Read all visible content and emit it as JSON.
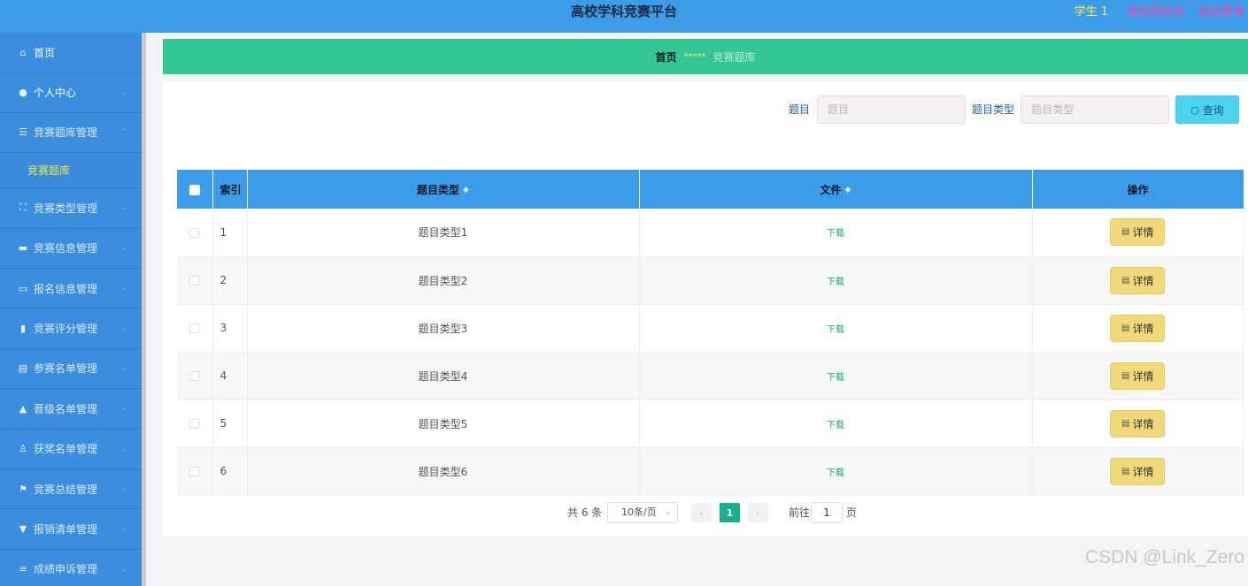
{
  "header": {
    "title": "高校学科竞赛平台",
    "user": "学生 1",
    "back_to_front": "退出到前台",
    "logout": "退出登录"
  },
  "sidebar": {
    "items": [
      {
        "label": "首页",
        "icon": "home-icon"
      },
      {
        "label": "个人中心",
        "icon": "user-icon"
      },
      {
        "label": "竞赛题库管理",
        "icon": "list-icon"
      },
      {
        "label": "竞赛类型管理",
        "icon": "expand-icon"
      },
      {
        "label": "竞赛信息管理",
        "icon": "briefcase-icon"
      },
      {
        "label": "报名信息管理",
        "icon": "message-icon"
      },
      {
        "label": "竞赛评分管理",
        "icon": "chart-icon"
      },
      {
        "label": "参赛名单管理",
        "icon": "clipboard-icon"
      },
      {
        "label": "晋级名单管理",
        "icon": "person-icon"
      },
      {
        "label": "获奖名单管理",
        "icon": "award-icon"
      },
      {
        "label": "竞赛总结管理",
        "icon": "flag-icon"
      },
      {
        "label": "报销清单管理",
        "icon": "pin-icon"
      },
      {
        "label": "成绩申诉管理",
        "icon": "menu-icon"
      }
    ],
    "sub_item": "竞赛题库"
  },
  "breadcrumb": {
    "home": "首页",
    "separator": "*****",
    "current": "竞赛题库"
  },
  "search": {
    "label_title": "题目",
    "placeholder_title": "题目",
    "label_type": "题目类型",
    "placeholder_type": "题目类型",
    "button": "查询"
  },
  "table": {
    "headers": {
      "index": "索引",
      "type": "题目类型",
      "file": "文件",
      "action": "操作"
    },
    "rows": [
      {
        "index": "1",
        "type": "题目类型1",
        "file": "下载",
        "action": "详情"
      },
      {
        "index": "2",
        "type": "题目类型2",
        "file": "下载",
        "action": "详情"
      },
      {
        "index": "3",
        "type": "题目类型3",
        "file": "下载",
        "action": "详情"
      },
      {
        "index": "4",
        "type": "题目类型4",
        "file": "下载",
        "action": "详情"
      },
      {
        "index": "5",
        "type": "题目类型5",
        "file": "下载",
        "action": "详情"
      },
      {
        "index": "6",
        "type": "题目类型6",
        "file": "下载",
        "action": "详情"
      }
    ]
  },
  "pagination": {
    "total": "共 6 条",
    "page_size": "10条/页",
    "current_page": "1",
    "goto_prefix": "前往",
    "goto_value": "1",
    "goto_suffix": "页"
  },
  "watermark": "CSDN @Link_Zero",
  "colors": {
    "header": "#3c9ce8",
    "sidebar": "#3b8ddf",
    "breadcrumb": "#33c795",
    "table_header": "#3b9ce9",
    "detail_button": "#f1d97a",
    "search_button": "#4cd4ee"
  }
}
